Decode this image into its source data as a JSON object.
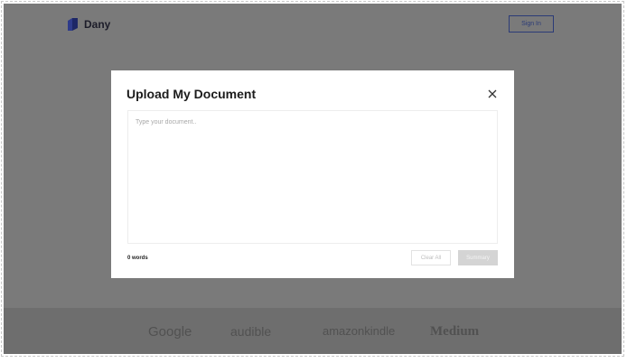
{
  "header": {
    "brand_name": "Dany",
    "sign_in_label": "Sign In"
  },
  "modal": {
    "title": "Upload My Document",
    "close_icon": "close-icon",
    "textarea_placeholder": "Type your document..",
    "textarea_value": "",
    "word_count": "0 words",
    "clear_label": "Clear All",
    "summary_label": "Summary"
  },
  "footer": {
    "brands": [
      "Google",
      "audible",
      "amazonkindle",
      "Medium"
    ]
  },
  "colors": {
    "overlay": "#7a7a7a",
    "accent": "#2b3b77"
  }
}
